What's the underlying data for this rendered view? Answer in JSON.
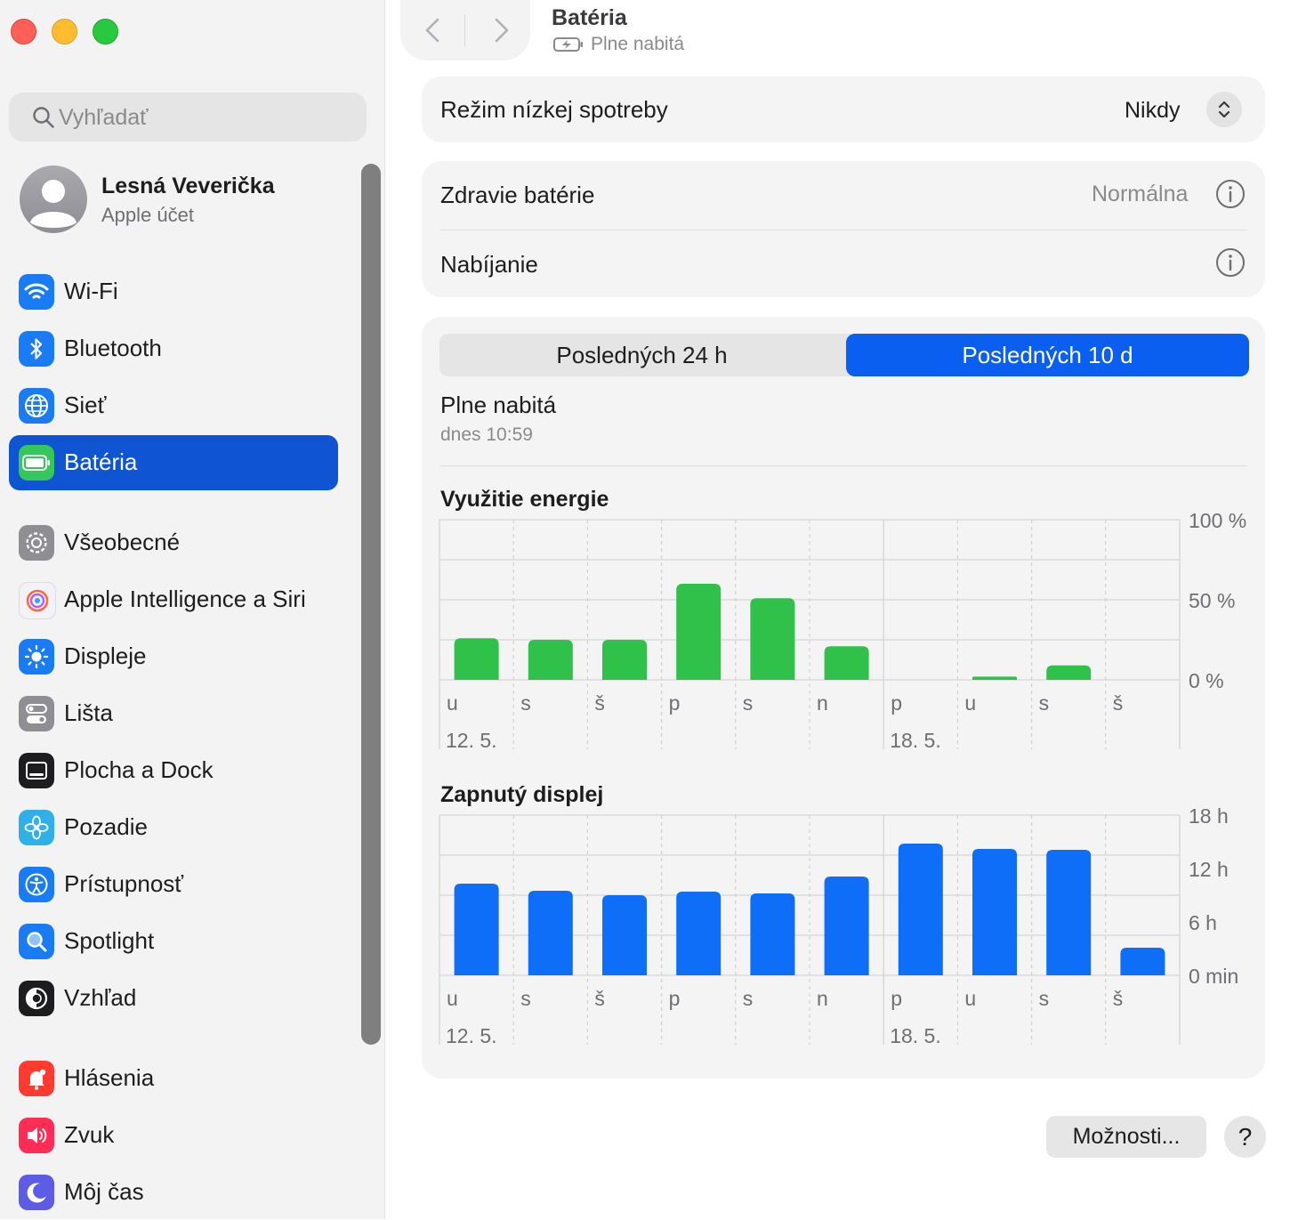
{
  "sidebar": {
    "search_placeholder": "Vyhľadať",
    "account": {
      "name": "Lesná Veverička",
      "subtitle": "Apple účet"
    },
    "items": [
      {
        "label": "Wi-Fi",
        "icon": "wifi-icon",
        "color": "#1a7cf5"
      },
      {
        "label": "Bluetooth",
        "icon": "bluetooth-icon",
        "color": "#1a7cf5"
      },
      {
        "label": "Sieť",
        "icon": "globe-icon",
        "color": "#1a7cf5"
      },
      {
        "label": "Batéria",
        "icon": "battery-icon",
        "color": "#34c759",
        "active": true
      },
      {
        "label": "Všeobecné",
        "icon": "gear-icon",
        "color": "#8e8e93"
      },
      {
        "label": "Apple Intelligence a Siri",
        "icon": "siri-icon",
        "color": "#f2f2f7"
      },
      {
        "label": "Displeje",
        "icon": "sun-icon",
        "color": "#1a7cf5"
      },
      {
        "label": "Lišta",
        "icon": "toggles-icon",
        "color": "#8e8e93"
      },
      {
        "label": "Plocha a Dock",
        "icon": "dock-icon",
        "color": "#1d1d1f"
      },
      {
        "label": "Pozadie",
        "icon": "flower-icon",
        "color": "#30b0e8"
      },
      {
        "label": "Prístupnosť",
        "icon": "accessibility-icon",
        "color": "#1a7cf5"
      },
      {
        "label": "Spotlight",
        "icon": "magnifier-icon",
        "color": "#1a7cf5"
      },
      {
        "label": "Vzhľad",
        "icon": "appearance-icon",
        "color": "#1d1d1f"
      },
      {
        "label": "Hlásenia",
        "icon": "bell-icon",
        "color": "#ff3b30"
      },
      {
        "label": "Zvuk",
        "icon": "speaker-icon",
        "color": "#ff2d55"
      },
      {
        "label": "Môj čas",
        "icon": "hourglass-moon-icon",
        "color": "#5e5ce6"
      }
    ]
  },
  "header": {
    "title": "Batéria",
    "subtitle": "Plne nabitá"
  },
  "low_power": {
    "label": "Režim nízkej spotreby",
    "value": "Nikdy"
  },
  "health": {
    "label": "Zdravie batérie",
    "value": "Normálna"
  },
  "charging": {
    "label": "Nabíjanie"
  },
  "segments": {
    "tab1": "Posledných 24 h",
    "tab2": "Posledných 10 d",
    "selected": 2
  },
  "status": {
    "title": "Plne nabitá",
    "time": "dnes 10:59"
  },
  "chart_data": [
    {
      "type": "bar",
      "title": "Využitie energie",
      "categories": [
        "u",
        "s",
        "š",
        "p",
        "s",
        "n",
        "p",
        "u",
        "s",
        "š"
      ],
      "date_labels": [
        {
          "index": 0,
          "text": "12. 5."
        },
        {
          "index": 6,
          "text": "18. 5."
        }
      ],
      "values": [
        26,
        25,
        25,
        60,
        51,
        21,
        0,
        2,
        9,
        0
      ],
      "y_ticks": [
        "100 %",
        "50 %",
        "0 %"
      ],
      "ylim": [
        0,
        100
      ],
      "color": "#2fc14a"
    },
    {
      "type": "bar",
      "title": "Zapnutý displej",
      "categories": [
        "u",
        "s",
        "š",
        "p",
        "s",
        "n",
        "p",
        "u",
        "s",
        "š"
      ],
      "date_labels": [
        {
          "index": 0,
          "text": "12. 5."
        },
        {
          "index": 6,
          "text": "18. 5."
        }
      ],
      "values": [
        10.3,
        9.5,
        9.0,
        9.4,
        9.2,
        11.1,
        14.8,
        14.2,
        14.1,
        3.1
      ],
      "y_ticks": [
        "18 h",
        "12 h",
        "6 h",
        "0 min"
      ],
      "ylim": [
        0,
        18
      ],
      "unit": "h",
      "color": "#0f6ef7"
    }
  ],
  "footer": {
    "options_label": "Možnosti...",
    "help_label": "?"
  }
}
